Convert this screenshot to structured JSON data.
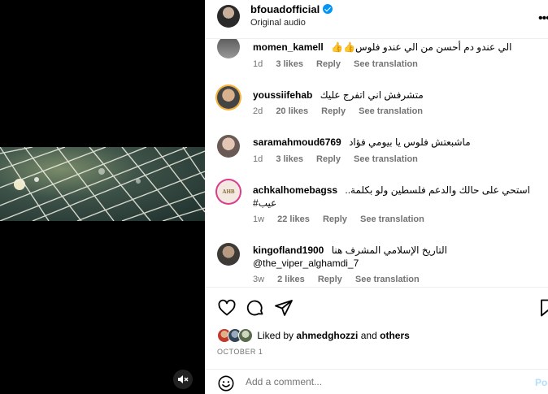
{
  "post": {
    "username": "bfouadofficial",
    "audio": "Original audio",
    "more_label": "•••"
  },
  "comments": [
    {
      "username": "momen_kamell",
      "text": "الي عندو دم أحسن من الي عندو فلوس👍👍",
      "age": "1d",
      "likes": "3 likes",
      "reply": "Reply",
      "translate": "See translation"
    },
    {
      "username": "youssiifehab",
      "text": "متشرفش اني اتفرج عليك",
      "age": "2d",
      "likes": "20 likes",
      "reply": "Reply",
      "translate": "See translation"
    },
    {
      "username": "saramahmoud6769",
      "text": "ماشبعتش فلوس يا بيومي فؤاد",
      "age": "1d",
      "likes": "3 likes",
      "reply": "Reply",
      "translate": "See translation"
    },
    {
      "username": "achkalhomebagss",
      "text": "استحي على حالك والدعم فلسطين ولو بكلمة..",
      "text2": "#عيب",
      "age": "1w",
      "likes": "22 likes",
      "reply": "Reply",
      "translate": "See translation"
    },
    {
      "username": "kingofland1900",
      "text": "التاريخ الإسلامي المشرف هنا",
      "text2": "@the_viper_alghamdi_7",
      "age": "3w",
      "likes": "2 likes",
      "reply": "Reply",
      "translate": "See translation"
    }
  ],
  "likes": {
    "prefix": "Liked by",
    "user": "ahmedghozzi",
    "joiner": "and",
    "others": "others"
  },
  "date": "OCTOBER 1",
  "add_comment": {
    "placeholder": "Add a comment...",
    "post_label": "Po"
  },
  "colors": {
    "verified": "#0095f6",
    "meta_text": "#737373",
    "post_button": "#b2dffc"
  },
  "icons": [
    "heart-icon",
    "comment-icon",
    "share-icon",
    "bookmark-icon",
    "mute-icon",
    "emoji-icon",
    "verified-badge-icon",
    "more-options-icon"
  ]
}
